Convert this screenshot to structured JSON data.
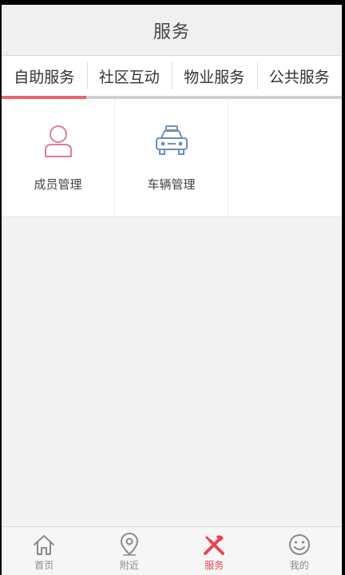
{
  "header": {
    "title": "服务"
  },
  "tabs": [
    {
      "label": "自助服务",
      "active": true
    },
    {
      "label": "社区互动",
      "active": false
    },
    {
      "label": "物业服务",
      "active": false
    },
    {
      "label": "公共服务",
      "active": false
    }
  ],
  "services": [
    {
      "label": "成员管理",
      "icon": "person-icon",
      "color": "#e07a9c"
    },
    {
      "label": "车辆管理",
      "icon": "car-icon",
      "color": "#6b8fb8"
    }
  ],
  "bottom_nav": [
    {
      "label": "首页",
      "icon": "home-icon",
      "active": false
    },
    {
      "label": "附近",
      "icon": "location-pin-icon",
      "active": false
    },
    {
      "label": "服务",
      "icon": "tools-icon",
      "active": true
    },
    {
      "label": "我的",
      "icon": "smiley-icon",
      "active": false
    }
  ],
  "colors": {
    "accent": "#e8646e",
    "active_nav": "#e8464f",
    "inactive_nav": "#8a8a8a"
  }
}
